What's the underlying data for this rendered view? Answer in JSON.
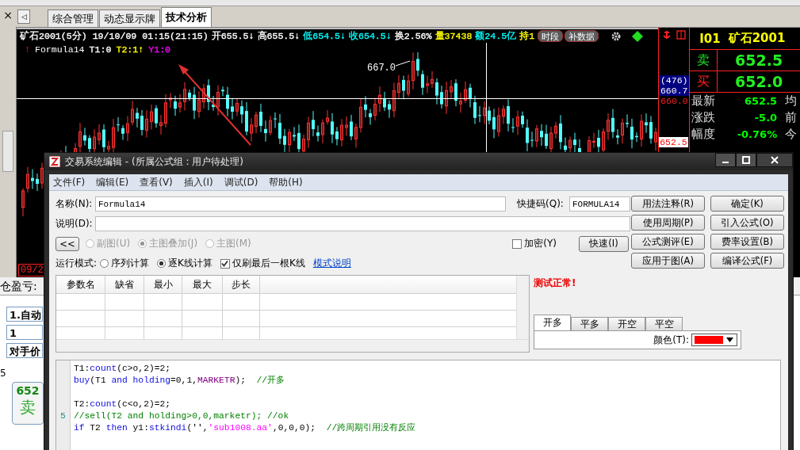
{
  "side_rail": {
    "close_glyph": "×"
  },
  "tabs": {
    "scroll_glyph": "◁",
    "items": [
      {
        "label": "综合管理",
        "selected": false
      },
      {
        "label": "动态显示牌",
        "selected": false
      },
      {
        "label": "技术分析",
        "selected": true
      }
    ]
  },
  "chart": {
    "header": [
      {
        "text": "矿石2001(5分) 19/10/09 01:15(21:15)",
        "kind": "title"
      },
      {
        "text": "开655.5↓",
        "kind": "open"
      },
      {
        "text": "高655.5↓",
        "kind": "high"
      },
      {
        "text": "低654.5↓",
        "kind": "low"
      },
      {
        "text": "收654.5↓",
        "kind": "close"
      },
      {
        "text": "换2.56%",
        "kind": "turnover"
      },
      {
        "text": "量37438",
        "kind": "volume"
      },
      {
        "text": "额24.5亿",
        "kind": "amount"
      },
      {
        "text": "持1",
        "kind": "interest"
      }
    ],
    "header_buttons": [
      "时段",
      "补数据"
    ],
    "indicator": {
      "arrow": "↑",
      "name": "Formula14",
      "values": [
        {
          "text": "T1:0",
          "color": "#ffffff"
        },
        {
          "text": "T2:1↑",
          "color": "#ffff00"
        },
        {
          "text": "Y1:0",
          "color": "#ff00ff"
        }
      ]
    },
    "peak_label": "667.0",
    "date_label": "09/2"
  },
  "price_axis": {
    "crosshair_count": "(476)",
    "crosshair_price": "660.7",
    "level_price": "660.0",
    "last_price": "652.5"
  },
  "quote": {
    "code": "I01",
    "name": "矿石2001",
    "book": [
      {
        "kind": "ask",
        "label": "卖",
        "price": "652.5"
      },
      {
        "kind": "bid",
        "label": "买",
        "price": "652.0"
      }
    ],
    "rows": [
      {
        "label": "最新",
        "value": "652.5",
        "next": "均"
      },
      {
        "label": "涨跌",
        "value": "-5.0",
        "next": "前"
      },
      {
        "label": "幅度",
        "value": "-0.76%",
        "next": "今"
      }
    ]
  },
  "order_panel": {
    "pnl_label": "仓盈亏:",
    "fields": [
      "1.自动",
      "1",
      "对手价"
    ],
    "quantity": "5",
    "sell_button": {
      "price": "652",
      "label": "卖"
    }
  },
  "dialog": {
    "title": "交易系统编辑 - (所属公式组 : 用户待处理)",
    "menu": [
      "文件(F)",
      "编辑(E)",
      "查看(V)",
      "插入(I)",
      "调试(D)",
      "帮助(H)"
    ],
    "name": {
      "label": "名称(N):",
      "value": "Formula14"
    },
    "shortcut": {
      "label": "快捷码(Q):",
      "value": "FORMULA14"
    },
    "description": {
      "label": "说明(D):"
    },
    "collapse_button": "<<",
    "chart_modes": [
      {
        "label": "副图(U)",
        "selected": false,
        "disabled": true
      },
      {
        "label": "主图叠加(J)",
        "selected": true,
        "disabled": true
      },
      {
        "label": "主图(M)",
        "selected": false,
        "disabled": true
      }
    ],
    "encrypt": {
      "label": "加密(Y)",
      "checked": false
    },
    "fast_button": "快速(I)",
    "run_mode": {
      "label": "运行模式:",
      "options": [
        {
          "label": "序列计算",
          "selected": false
        },
        {
          "label": "逐K线计算",
          "selected": true
        }
      ]
    },
    "last_bar_only": {
      "label": "仅刷最后一根K线",
      "checked": true
    },
    "mode_help_link": "模式说明",
    "buttons": [
      "用法注释(R)",
      "确定(K)",
      "使用周期(P)",
      "引入公式(O)",
      "公式测评(E)",
      "费率设置(B)",
      "应用于图(A)",
      "编译公式(F)"
    ],
    "params": {
      "columns": [
        "参数名",
        "缺省",
        "最小",
        "最大",
        "步长"
      ]
    },
    "status": "测试正常!",
    "signal_tabs": [
      {
        "label": "开多",
        "selected": true
      },
      {
        "label": "平多",
        "selected": false
      },
      {
        "label": "开空",
        "selected": false
      },
      {
        "label": "平空",
        "selected": false
      }
    ],
    "color_field": {
      "label": "颜色(T):",
      "color": "#ff0000"
    },
    "code_lines": [
      {
        "kind": "code",
        "tokens": [
          {
            "text": "T1:",
            "kind": "plain"
          },
          {
            "text": "count",
            "kind": "keyword"
          },
          {
            "text": "(c>o,2)=2;",
            "kind": "plain"
          }
        ]
      },
      {
        "kind": "code",
        "tokens": [
          {
            "text": "buy",
            "kind": "keyword"
          },
          {
            "text": "(T1 ",
            "kind": "plain"
          },
          {
            "text": "and holding",
            "kind": "keyword"
          },
          {
            "text": "=0,1,",
            "kind": "plain"
          },
          {
            "text": "MARKETR",
            "kind": "constant"
          },
          {
            "text": ");  ",
            "kind": "plain"
          },
          {
            "text": "//开多",
            "kind": "comment"
          }
        ]
      },
      {
        "kind": "blank"
      },
      {
        "kind": "code",
        "tokens": [
          {
            "text": "T2:",
            "kind": "plain"
          },
          {
            "text": "count",
            "kind": "keyword"
          },
          {
            "text": "(c<o,2)=2;",
            "kind": "plain"
          }
        ]
      },
      {
        "kind": "code",
        "gutter": "5",
        "tokens": [
          {
            "text": "//sell(T2 and holding>0,0,marketr); //ok",
            "kind": "comment"
          }
        ]
      },
      {
        "kind": "code",
        "tokens": [
          {
            "text": "if",
            "kind": "keyword"
          },
          {
            "text": " T2 ",
            "kind": "plain"
          },
          {
            "text": "then",
            "kind": "keyword"
          },
          {
            "text": " y1:",
            "kind": "plain"
          },
          {
            "text": "stkindi",
            "kind": "keyword"
          },
          {
            "text": "('',",
            "kind": "plain"
          },
          {
            "text": "'sub1008.aa'",
            "kind": "string"
          },
          {
            "text": ",0,0,0);  ",
            "kind": "plain"
          },
          {
            "text": "//跨周期引用没有反应",
            "kind": "comment"
          }
        ]
      }
    ]
  }
}
